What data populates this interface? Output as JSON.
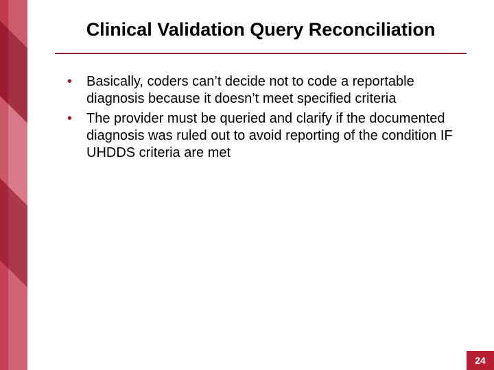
{
  "colors": {
    "accent": "#b71f33",
    "rule": "#9a1b2f"
  },
  "title": "Clinical Validation Query Reconciliation",
  "bullets": [
    "Basically, coders can’t decide not to code a reportable diagnosis because it doesn’t meet specified criteria",
    "The provider must be queried and clarify if the documented diagnosis was ruled out to avoid reporting of the condition IF UHDDS criteria are met"
  ],
  "page_number": "24"
}
